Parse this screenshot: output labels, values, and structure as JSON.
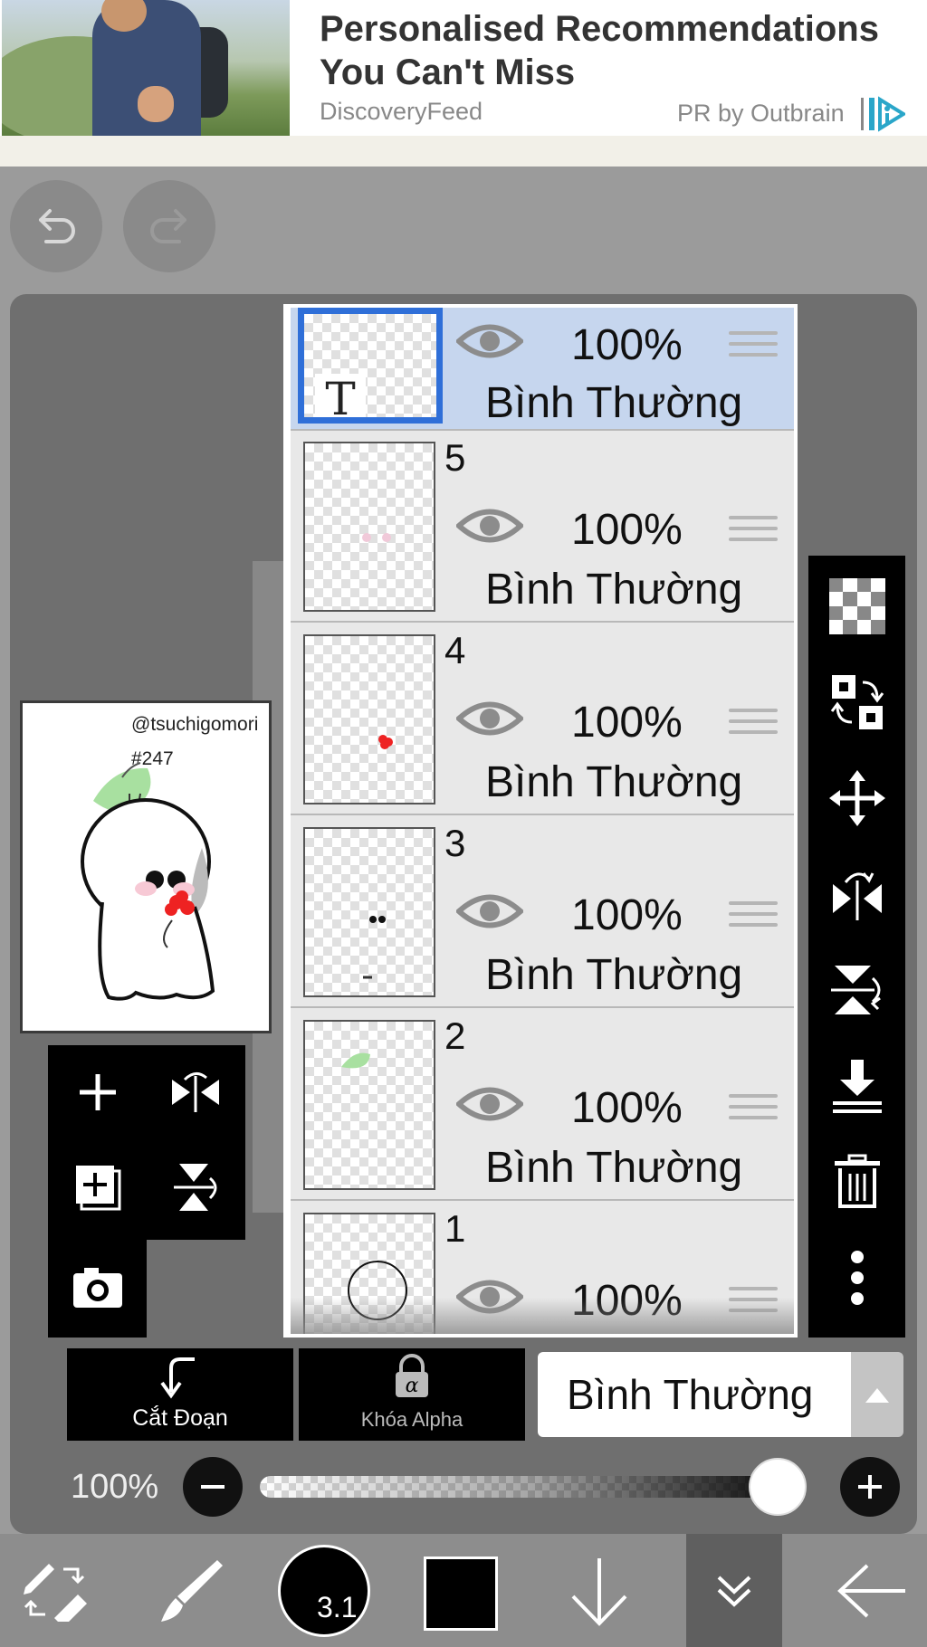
{
  "ad": {
    "title": "Personalised Recommendations You Can't Miss",
    "source": "DiscoveryFeed",
    "sponsor": "PR by Outbrain"
  },
  "artwork": {
    "handle": "@tsuchigomori",
    "number": "#247"
  },
  "layers": [
    {
      "name": "",
      "opacity": "100%",
      "blend": "Bình Thường",
      "selected": true,
      "type": "text",
      "thumb_label": "T"
    },
    {
      "name": "5",
      "opacity": "100%",
      "blend": "Bình Thường"
    },
    {
      "name": "4",
      "opacity": "100%",
      "blend": "Bình Thường"
    },
    {
      "name": "3",
      "opacity": "100%",
      "blend": "Bình Thường"
    },
    {
      "name": "2",
      "opacity": "100%",
      "blend": "Bình Thường"
    },
    {
      "name": "1",
      "opacity": "100%",
      "blend": "Bình Thường"
    }
  ],
  "controls": {
    "clipping_label": "Cắt Đoạn",
    "alpha_lock_label": "Khóa Alpha",
    "blend_mode": "Bình Thường",
    "opacity_label": "100%",
    "opacity_value": 1.0
  },
  "toolbar": {
    "brush_size": "3.1",
    "color": "#000000"
  },
  "colors": {
    "selected_layer": "#c6d6ee",
    "selection_border": "#2f6fd8",
    "panel_bg": "#e8e8e8"
  }
}
